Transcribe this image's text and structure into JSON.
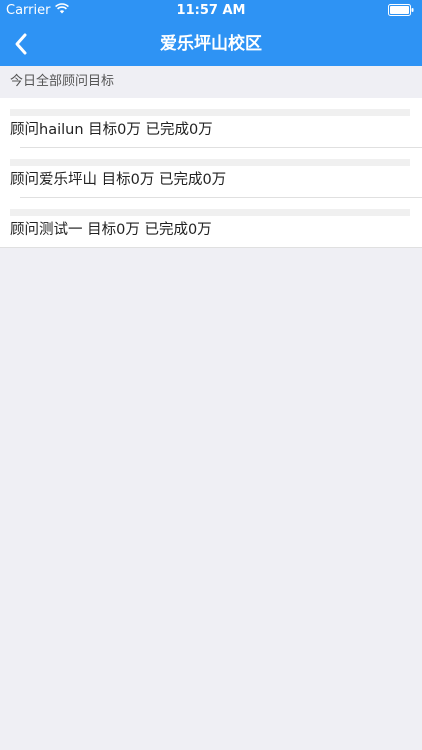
{
  "status_bar": {
    "carrier": "Carrier",
    "time": "11:57 AM"
  },
  "nav": {
    "title": "爱乐坪山校区"
  },
  "section": {
    "header": "今日全部顾问目标"
  },
  "rows": [
    {
      "text": "顾问hailun 目标0万 已完成0万"
    },
    {
      "text": "顾问爱乐坪山 目标0万 已完成0万"
    },
    {
      "text": "顾问测试一 目标0万 已完成0万"
    }
  ],
  "colors": {
    "accent": "#2e93f4",
    "background": "#efeff4"
  }
}
